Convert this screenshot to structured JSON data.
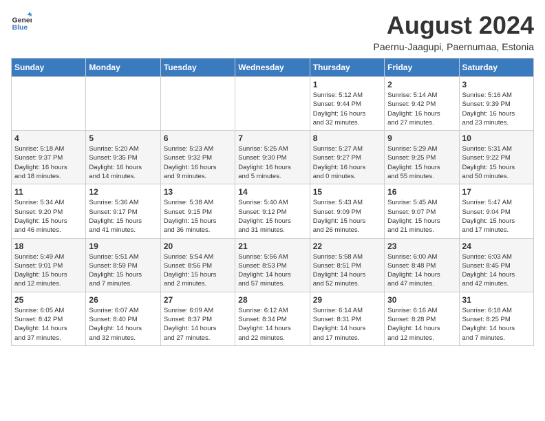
{
  "header": {
    "logo_line1": "General",
    "logo_line2": "Blue",
    "month_year": "August 2024",
    "location": "Paernu-Jaagupi, Paernumaa, Estonia"
  },
  "columns": [
    "Sunday",
    "Monday",
    "Tuesday",
    "Wednesday",
    "Thursday",
    "Friday",
    "Saturday"
  ],
  "weeks": [
    [
      {
        "day": "",
        "info": ""
      },
      {
        "day": "",
        "info": ""
      },
      {
        "day": "",
        "info": ""
      },
      {
        "day": "",
        "info": ""
      },
      {
        "day": "1",
        "info": "Sunrise: 5:12 AM\nSunset: 9:44 PM\nDaylight: 16 hours\nand 32 minutes."
      },
      {
        "day": "2",
        "info": "Sunrise: 5:14 AM\nSunset: 9:42 PM\nDaylight: 16 hours\nand 27 minutes."
      },
      {
        "day": "3",
        "info": "Sunrise: 5:16 AM\nSunset: 9:39 PM\nDaylight: 16 hours\nand 23 minutes."
      }
    ],
    [
      {
        "day": "4",
        "info": "Sunrise: 5:18 AM\nSunset: 9:37 PM\nDaylight: 16 hours\nand 18 minutes."
      },
      {
        "day": "5",
        "info": "Sunrise: 5:20 AM\nSunset: 9:35 PM\nDaylight: 16 hours\nand 14 minutes."
      },
      {
        "day": "6",
        "info": "Sunrise: 5:23 AM\nSunset: 9:32 PM\nDaylight: 16 hours\nand 9 minutes."
      },
      {
        "day": "7",
        "info": "Sunrise: 5:25 AM\nSunset: 9:30 PM\nDaylight: 16 hours\nand 5 minutes."
      },
      {
        "day": "8",
        "info": "Sunrise: 5:27 AM\nSunset: 9:27 PM\nDaylight: 16 hours\nand 0 minutes."
      },
      {
        "day": "9",
        "info": "Sunrise: 5:29 AM\nSunset: 9:25 PM\nDaylight: 15 hours\nand 55 minutes."
      },
      {
        "day": "10",
        "info": "Sunrise: 5:31 AM\nSunset: 9:22 PM\nDaylight: 15 hours\nand 50 minutes."
      }
    ],
    [
      {
        "day": "11",
        "info": "Sunrise: 5:34 AM\nSunset: 9:20 PM\nDaylight: 15 hours\nand 46 minutes."
      },
      {
        "day": "12",
        "info": "Sunrise: 5:36 AM\nSunset: 9:17 PM\nDaylight: 15 hours\nand 41 minutes."
      },
      {
        "day": "13",
        "info": "Sunrise: 5:38 AM\nSunset: 9:15 PM\nDaylight: 15 hours\nand 36 minutes."
      },
      {
        "day": "14",
        "info": "Sunrise: 5:40 AM\nSunset: 9:12 PM\nDaylight: 15 hours\nand 31 minutes."
      },
      {
        "day": "15",
        "info": "Sunrise: 5:43 AM\nSunset: 9:09 PM\nDaylight: 15 hours\nand 26 minutes."
      },
      {
        "day": "16",
        "info": "Sunrise: 5:45 AM\nSunset: 9:07 PM\nDaylight: 15 hours\nand 21 minutes."
      },
      {
        "day": "17",
        "info": "Sunrise: 5:47 AM\nSunset: 9:04 PM\nDaylight: 15 hours\nand 17 minutes."
      }
    ],
    [
      {
        "day": "18",
        "info": "Sunrise: 5:49 AM\nSunset: 9:01 PM\nDaylight: 15 hours\nand 12 minutes."
      },
      {
        "day": "19",
        "info": "Sunrise: 5:51 AM\nSunset: 8:59 PM\nDaylight: 15 hours\nand 7 minutes."
      },
      {
        "day": "20",
        "info": "Sunrise: 5:54 AM\nSunset: 8:56 PM\nDaylight: 15 hours\nand 2 minutes."
      },
      {
        "day": "21",
        "info": "Sunrise: 5:56 AM\nSunset: 8:53 PM\nDaylight: 14 hours\nand 57 minutes."
      },
      {
        "day": "22",
        "info": "Sunrise: 5:58 AM\nSunset: 8:51 PM\nDaylight: 14 hours\nand 52 minutes."
      },
      {
        "day": "23",
        "info": "Sunrise: 6:00 AM\nSunset: 8:48 PM\nDaylight: 14 hours\nand 47 minutes."
      },
      {
        "day": "24",
        "info": "Sunrise: 6:03 AM\nSunset: 8:45 PM\nDaylight: 14 hours\nand 42 minutes."
      }
    ],
    [
      {
        "day": "25",
        "info": "Sunrise: 6:05 AM\nSunset: 8:42 PM\nDaylight: 14 hours\nand 37 minutes."
      },
      {
        "day": "26",
        "info": "Sunrise: 6:07 AM\nSunset: 8:40 PM\nDaylight: 14 hours\nand 32 minutes."
      },
      {
        "day": "27",
        "info": "Sunrise: 6:09 AM\nSunset: 8:37 PM\nDaylight: 14 hours\nand 27 minutes."
      },
      {
        "day": "28",
        "info": "Sunrise: 6:12 AM\nSunset: 8:34 PM\nDaylight: 14 hours\nand 22 minutes."
      },
      {
        "day": "29",
        "info": "Sunrise: 6:14 AM\nSunset: 8:31 PM\nDaylight: 14 hours\nand 17 minutes."
      },
      {
        "day": "30",
        "info": "Sunrise: 6:16 AM\nSunset: 8:28 PM\nDaylight: 14 hours\nand 12 minutes."
      },
      {
        "day": "31",
        "info": "Sunrise: 6:18 AM\nSunset: 8:25 PM\nDaylight: 14 hours\nand 7 minutes."
      }
    ]
  ]
}
